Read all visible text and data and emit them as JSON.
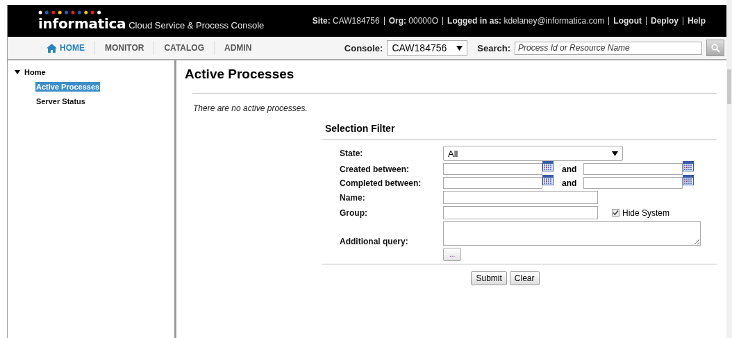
{
  "header": {
    "logo": "informatica",
    "product": "Cloud Service & Process Console",
    "site_label": "Site:",
    "site": "CAW184756",
    "org_label": "Org:",
    "org": "00000O",
    "login_label": "Logged in as:",
    "user": "kdelaney@informatica.com",
    "links": [
      "Logout",
      "Deploy",
      "Help"
    ]
  },
  "nav": {
    "tabs": [
      {
        "label": "HOME",
        "selected": true
      },
      {
        "label": "MONITOR",
        "selected": false
      },
      {
        "label": "CATALOG",
        "selected": false
      },
      {
        "label": "ADMIN",
        "selected": false
      }
    ],
    "console_label": "Console:",
    "console_value": "CAW184756",
    "search_label": "Search:",
    "search_placeholder": "Process Id or Resource Name"
  },
  "sidebar": {
    "items": [
      {
        "label": "Home",
        "expanded": true,
        "children": [
          {
            "label": "Active Processes",
            "selected": true
          },
          {
            "label": "Server Status",
            "selected": false
          }
        ]
      }
    ]
  },
  "main": {
    "title": "Active Processes",
    "message": "There are no active processes.",
    "filter": {
      "title": "Selection Filter",
      "rows": [
        {
          "kind": "select",
          "label": "State:",
          "value": "All"
        },
        {
          "kind": "range",
          "label": "Created between:",
          "joiner": "and"
        },
        {
          "kind": "range",
          "label": "Completed between:",
          "joiner": "and"
        },
        {
          "kind": "text",
          "label": "Name:"
        },
        {
          "kind": "text",
          "label": "Group:",
          "checkbox": {
            "label": "Hide System",
            "checked": true
          }
        },
        {
          "kind": "textarea",
          "label": "Additional query:",
          "button": "..."
        }
      ],
      "buttons": [
        "Submit",
        "Clear"
      ]
    }
  }
}
